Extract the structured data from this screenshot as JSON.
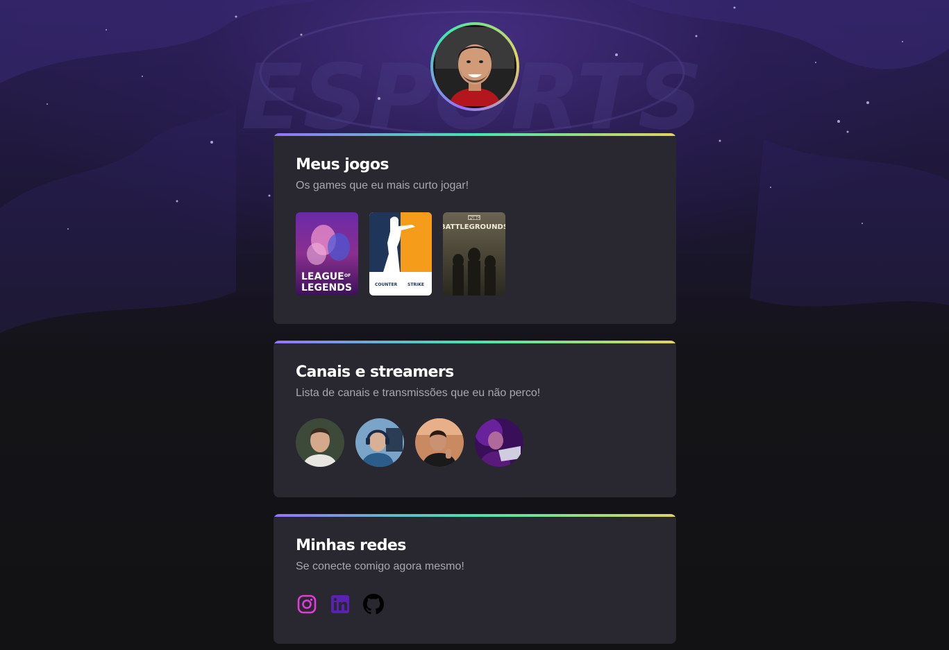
{
  "profile": {
    "avatar_alt": "Foto de perfil"
  },
  "background": {
    "watermark_text": "ESPORTS"
  },
  "colors": {
    "gradient": [
      "#9572FC",
      "#43E7AD",
      "#E2D45C"
    ],
    "card_bg": "#29272F",
    "page_bg": "#121214"
  },
  "sections": {
    "games": {
      "title": "Meus jogos",
      "subtitle": "Os games que eu mais curto jogar!",
      "items": [
        {
          "name": "league-of-legends",
          "line1": "LEAGUE",
          "of": "OF",
          "line2": "LEGENDS"
        },
        {
          "name": "counter-strike",
          "label_left": "COUNTER",
          "label_right": "STRIKE"
        },
        {
          "name": "pubg-battlegrounds",
          "top": "PUBG",
          "main": "BATTLEGROUNDS"
        }
      ]
    },
    "streamers": {
      "title": "Canais e streamers",
      "subtitle": "Lista de canais e transmissões que eu não perco!",
      "items": [
        {
          "name": "streamer-1"
        },
        {
          "name": "streamer-2"
        },
        {
          "name": "streamer-3"
        },
        {
          "name": "streamer-4"
        }
      ]
    },
    "social": {
      "title": "Minhas redes",
      "subtitle": "Se conecte comigo agora mesmo!",
      "items": [
        {
          "icon": "instagram-icon",
          "color": "#E33BD8"
        },
        {
          "icon": "linkedin-icon",
          "color": "#5B21B6"
        },
        {
          "icon": "github-icon",
          "color": "#000000"
        }
      ]
    }
  }
}
